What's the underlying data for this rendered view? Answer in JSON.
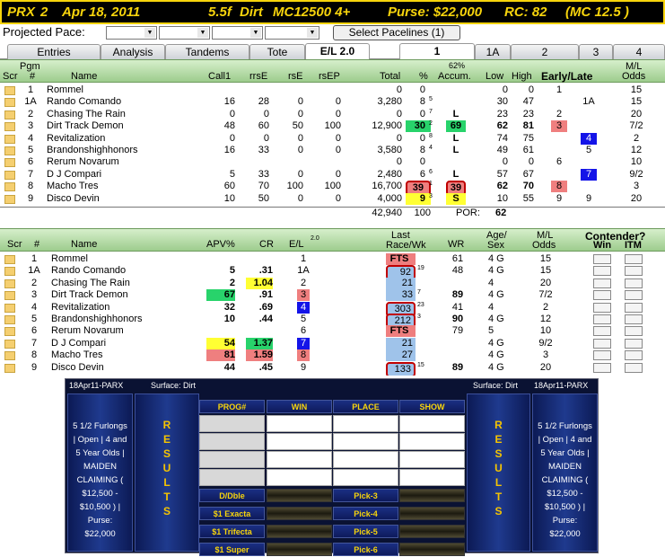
{
  "title": {
    "track": "PRX",
    "race": "2",
    "date": "Apr 18, 2011",
    "dist": "5.5f",
    "surface": "Dirt",
    "class": "MC12500 4+",
    "purse": "Purse: $22,000",
    "rc": "RC: 82",
    "mc": "(MC 12.5 )"
  },
  "pace": {
    "label": "Projected Pace:",
    "button": "Select Pacelines  (1)"
  },
  "tabs": [
    "Entries",
    "Analysis",
    "Tandems",
    "Tote",
    "E/L 2.0"
  ],
  "race_tabs": [
    "1",
    "1A",
    "2",
    "3",
    "4"
  ],
  "top_header": {
    "scr": "Scr",
    "pgm": "Pgm",
    "pgm2": "#",
    "name": "Name",
    "call1": "Call1",
    "rrse": "rrsE",
    "rse": "rsE",
    "rsep": "rsEP",
    "total": "Total",
    "pct": "%",
    "accum_pct": "62%",
    "accum": "Accum.",
    "low": "Low",
    "high": "High",
    "early_late": "Early/Late",
    "ml": "M/L",
    "odds": "Odds"
  },
  "top_rows": [
    {
      "pgm": "1",
      "name": "Rommel",
      "call1": "",
      "rrse": "",
      "rse": "",
      "rsep": "",
      "total": "0",
      "pct": "0",
      "pct_sup": "",
      "accum": "",
      "low": "0",
      "high": "0",
      "early": "1",
      "late": "",
      "ml": "15"
    },
    {
      "pgm": "1A",
      "name": "Rando Comando",
      "call1": "16",
      "rrse": "28",
      "rse": "0",
      "rsep": "0",
      "total": "3,280",
      "pct": "8",
      "pct_sup": "5",
      "accum": "",
      "low": "30",
      "high": "47",
      "early": "",
      "late": "1A",
      "ml": "15"
    },
    {
      "pgm": "2",
      "name": "Chasing The Rain",
      "call1": "0",
      "rrse": "0",
      "rse": "0",
      "rsep": "0",
      "total": "0",
      "pct": "0",
      "pct_sup": "7",
      "accum": "L",
      "low": "23",
      "high": "23",
      "early": "2",
      "late": "",
      "ml": "20"
    },
    {
      "pgm": "3",
      "name": "Dirt Track Demon",
      "call1": "48",
      "rrse": "60",
      "rse": "50",
      "rsep": "100",
      "total": "12,900",
      "pct": "30",
      "pct_sup": "2",
      "accum": "69",
      "low": "62",
      "high": "81",
      "early": "3",
      "late": "",
      "ml": "7/2"
    },
    {
      "pgm": "4",
      "name": "Revitalization",
      "call1": "0",
      "rrse": "0",
      "rse": "0",
      "rsep": "0",
      "total": "0",
      "pct": "0",
      "pct_sup": "8",
      "accum": "L",
      "low": "74",
      "high": "75",
      "early": "",
      "late": "4",
      "ml": "2"
    },
    {
      "pgm": "5",
      "name": "Brandonshighhonors",
      "call1": "16",
      "rrse": "33",
      "rse": "0",
      "rsep": "0",
      "total": "3,580",
      "pct": "8",
      "pct_sup": "4",
      "accum": "L",
      "low": "49",
      "high": "61",
      "early": "",
      "late": "5",
      "ml": "12"
    },
    {
      "pgm": "6",
      "name": "Rerum Novarum",
      "call1": "",
      "rrse": "",
      "rse": "",
      "rsep": "",
      "total": "0",
      "pct": "0",
      "pct_sup": "",
      "accum": "",
      "low": "0",
      "high": "0",
      "early": "6",
      "late": "",
      "ml": "10"
    },
    {
      "pgm": "7",
      "name": "D J Compari",
      "call1": "5",
      "rrse": "33",
      "rse": "0",
      "rsep": "0",
      "total": "2,480",
      "pct": "6",
      "pct_sup": "6",
      "accum": "L",
      "low": "57",
      "high": "67",
      "early": "",
      "late": "7",
      "ml": "9/2"
    },
    {
      "pgm": "8",
      "name": "Macho Tres",
      "call1": "60",
      "rrse": "70",
      "rse": "100",
      "rsep": "100",
      "total": "16,700",
      "pct": "39",
      "pct_sup": "1",
      "accum": "39",
      "low": "62",
      "high": "70",
      "early": "8",
      "late": "",
      "ml": "3"
    },
    {
      "pgm": "9",
      "name": "Disco Devin",
      "call1": "10",
      "rrse": "50",
      "rse": "0",
      "rsep": "0",
      "total": "4,000",
      "pct": "9",
      "pct_sup": "3",
      "accum": "S",
      "low": "10",
      "high": "55",
      "early": "9",
      "late": "9",
      "ml": "20"
    }
  ],
  "totals": {
    "total": "42,940",
    "pct": "100",
    "por_label": "POR:",
    "por": "62"
  },
  "bot_header": {
    "scr": "Scr",
    "num": "#",
    "name": "Name",
    "apv": "APV%",
    "cr": "CR",
    "el": "E/L",
    "el_sup": "2.0",
    "last": "Last",
    "racewk": "Race/Wk",
    "wr": "WR",
    "age": "Age/",
    "sex": "Sex",
    "ml": "M/L",
    "odds": "Odds",
    "contender": "Contender?",
    "win": "Win",
    "itm": "ITM"
  },
  "bot_rows": [
    {
      "pgm": "1",
      "name": "Rommel",
      "apv": "",
      "cr": "",
      "el": "1",
      "last": "FTS",
      "wk": "",
      "wr": "61",
      "age": "4 G",
      "ml": "15"
    },
    {
      "pgm": "1A",
      "name": "Rando Comando",
      "apv": "5",
      "cr": ".31",
      "el": "1A",
      "last": "92",
      "wk": "19",
      "wr": "48",
      "age": "4 G",
      "ml": "15"
    },
    {
      "pgm": "2",
      "name": "Chasing The Rain",
      "apv": "2",
      "cr": "1.04",
      "el": "2",
      "last": "21",
      "wk": "",
      "wr": "",
      "age": "4",
      "ml": "20"
    },
    {
      "pgm": "3",
      "name": "Dirt Track Demon",
      "apv": "67",
      "cr": ".91",
      "el": "3",
      "last": "33",
      "wk": "7",
      "wr": "89",
      "age": "4 G",
      "ml": "7/2"
    },
    {
      "pgm": "4",
      "name": "Revitalization",
      "apv": "32",
      "cr": ".69",
      "el": "4",
      "last": "303",
      "wk": "23",
      "wr": "41",
      "age": "4",
      "ml": "2"
    },
    {
      "pgm": "5",
      "name": "Brandonshighhonors",
      "apv": "10",
      "cr": ".44",
      "el": "5",
      "last": "212",
      "wk": "3",
      "wr": "90",
      "age": "4 G",
      "ml": "12"
    },
    {
      "pgm": "6",
      "name": "Rerum Novarum",
      "apv": "",
      "cr": "",
      "el": "6",
      "last": "FTS",
      "wk": "",
      "wr": "79",
      "age": "5",
      "ml": "10"
    },
    {
      "pgm": "7",
      "name": "D J Compari",
      "apv": "54",
      "cr": "1.37",
      "el": "7",
      "last": "21",
      "wk": "",
      "wr": "",
      "age": "4 G",
      "ml": "9/2"
    },
    {
      "pgm": "8",
      "name": "Macho Tres",
      "apv": "81",
      "cr": "1.59",
      "el": "8",
      "last": "27",
      "wk": "",
      "wr": "",
      "age": "4 G",
      "ml": "3"
    },
    {
      "pgm": "9",
      "name": "Disco Devin",
      "apv": "44",
      "cr": ".45",
      "el": "9",
      "last": "133",
      "wk": "15",
      "wr": "89",
      "age": "4 G",
      "ml": "20"
    }
  ],
  "board": {
    "left_date": "18Apr11-PARX",
    "left_surface": "Surface: Dirt",
    "right_surface": "Surface: Dirt",
    "right_date": "18Apr11-PARX",
    "info": [
      "5 1/2 Furlongs",
      "| Open | 4 and",
      "5 Year Olds |",
      "MAIDEN",
      "CLAIMING (",
      "$12,500 -",
      "$10,500 ) |",
      "Purse:",
      "$22,000"
    ],
    "results": [
      "R",
      "E",
      "S",
      "U",
      "L",
      "T",
      "S"
    ],
    "cols": [
      "PROG#",
      "WIN",
      "PLACE",
      "SHOW"
    ],
    "exotics_left": [
      "D/Dble",
      "$1 Exacta",
      "$1 Trifecta",
      "$1 Super"
    ],
    "exotics_right": [
      "Pick-3",
      "Pick-4",
      "Pick-5",
      "Pick-6"
    ]
  }
}
